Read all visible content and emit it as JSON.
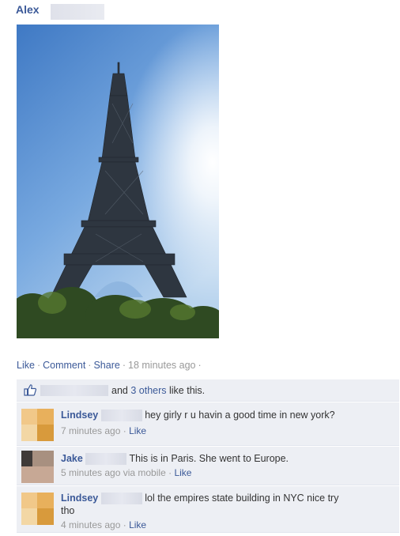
{
  "post": {
    "author": "Alex",
    "actions": {
      "like": "Like",
      "comment": "Comment",
      "share": "Share",
      "sep": "·",
      "time": "18 minutes ago",
      "trailing": "·"
    },
    "likes": {
      "and": "and",
      "others": "3 others",
      "suffix": "like this."
    }
  },
  "comments": [
    {
      "name": "Lindsey",
      "text": "hey girly r u havin a good time in new york?",
      "time": "7 minutes ago",
      "sep": "·",
      "like": "Like"
    },
    {
      "name": "Jake",
      "text": "This is in Paris. She went to Europe.",
      "time": "5 minutes ago via mobile",
      "sep": "·",
      "like": "Like"
    },
    {
      "name": "Lindsey",
      "text": "lol the empires state building in NYC nice try",
      "text2": "tho",
      "time": "4 minutes ago",
      "sep": "·",
      "like": "Like"
    }
  ],
  "colors": {
    "link": "#3b5998",
    "meta": "#999999",
    "feedback_bg": "#edeff4"
  },
  "icons": {
    "like": "thumbs-up-icon"
  }
}
